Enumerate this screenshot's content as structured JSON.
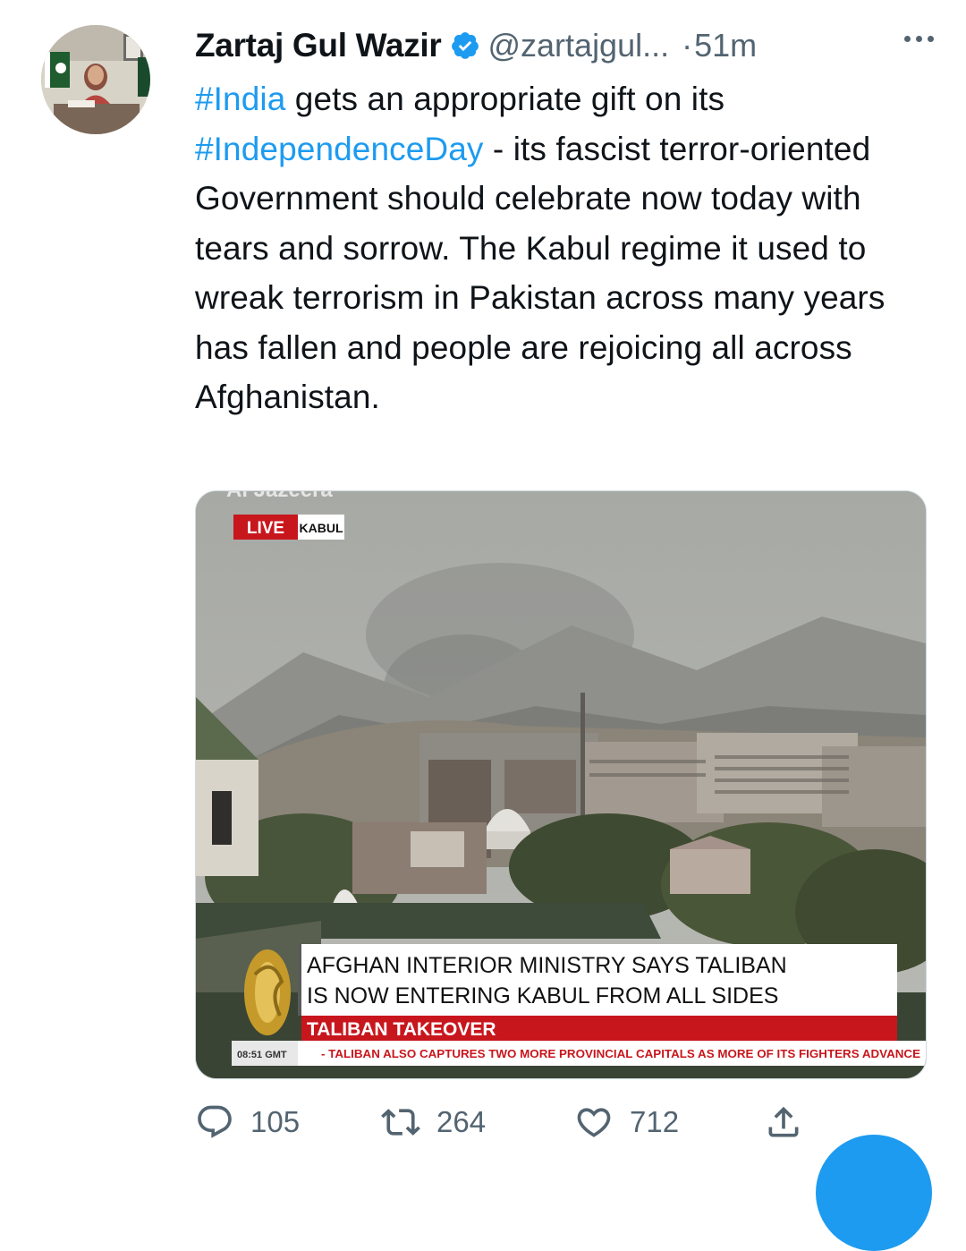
{
  "tweet": {
    "author": "Zartaj Gul Wazir",
    "handle": "@zartajgul...",
    "separator": "·",
    "time": "51m",
    "text_parts": [
      {
        "text": "#India",
        "hashtag": true
      },
      {
        "text": " gets an appropriate gift on its ",
        "hashtag": false
      },
      {
        "text": "#IndependenceDay",
        "hashtag": true
      },
      {
        "text": " - its fascist terror-oriented Government should celebrate now today with tears and sorrow. The Kabul regime it used to wreak terrorism in Pakistan across many years has fallen and people are rejoicing all across Afghanistan.",
        "hashtag": false
      }
    ]
  },
  "media": {
    "watermark": "Al Jazeera",
    "live_label": "LIVE",
    "location_label": "KABUL",
    "headline_line1": "AFGHAN INTERIOR MINISTRY SAYS TALIBAN",
    "headline_line2": "IS NOW ENTERING KABUL FROM ALL SIDES",
    "banner": "TALIBAN TAKEOVER",
    "clock": "08:51 GMT",
    "ticker": "- TALIBAN ALSO CAPTURES TWO MORE PROVINCIAL CAPITALS AS MORE OF ITS FIGHTERS ADVANCE"
  },
  "actions": {
    "replies": "105",
    "retweets": "264",
    "likes": "712"
  },
  "colors": {
    "accent": "#1d9bf0",
    "text": "#0f1419",
    "secondary": "#536471",
    "live_red": "#c8161d"
  },
  "icons": [
    "verified-badge-icon",
    "more-icon",
    "reply-icon",
    "retweet-icon",
    "like-icon",
    "share-icon",
    "compose-icon"
  ]
}
